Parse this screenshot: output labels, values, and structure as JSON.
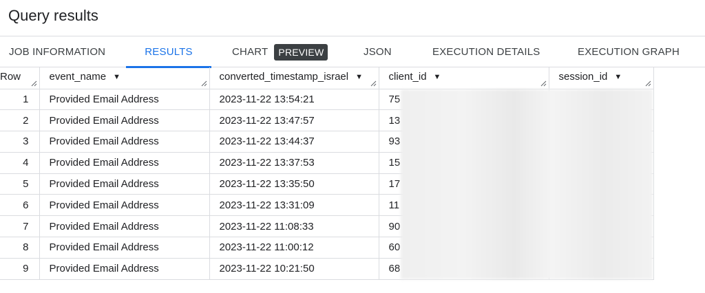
{
  "title": "Query results",
  "tabs": {
    "job_information": "JOB INFORMATION",
    "results": "RESULTS",
    "chart": "CHART",
    "chart_badge": "PREVIEW",
    "json": "JSON",
    "execution_details": "EXECUTION DETAILS",
    "execution_graph": "EXECUTION GRAPH"
  },
  "table": {
    "columns": [
      "Row",
      "event_name",
      "converted_timestamp_israel",
      "client_id",
      "session_id"
    ],
    "rows": [
      {
        "row": "1",
        "event_name": "Provided Email Address",
        "timestamp": "2023-11-22 13:54:21",
        "client_id": "75",
        "session_id": ""
      },
      {
        "row": "2",
        "event_name": "Provided Email Address",
        "timestamp": "2023-11-22 13:47:57",
        "client_id": "13",
        "session_id": ""
      },
      {
        "row": "3",
        "event_name": "Provided Email Address",
        "timestamp": "2023-11-22 13:44:37",
        "client_id": "93",
        "session_id": ""
      },
      {
        "row": "4",
        "event_name": "Provided Email Address",
        "timestamp": "2023-11-22 13:37:53",
        "client_id": "15",
        "session_id": ""
      },
      {
        "row": "5",
        "event_name": "Provided Email Address",
        "timestamp": "2023-11-22 13:35:50",
        "client_id": "17",
        "session_id": ""
      },
      {
        "row": "6",
        "event_name": "Provided Email Address",
        "timestamp": "2023-11-22 13:31:09",
        "client_id": "11",
        "session_id": ""
      },
      {
        "row": "7",
        "event_name": "Provided Email Address",
        "timestamp": "2023-11-22 11:08:33",
        "client_id": "90",
        "session_id": ""
      },
      {
        "row": "8",
        "event_name": "Provided Email Address",
        "timestamp": "2023-11-22 11:00:12",
        "client_id": "60",
        "session_id": ""
      },
      {
        "row": "9",
        "event_name": "Provided Email Address",
        "timestamp": "2023-11-22 10:21:50",
        "client_id": "68",
        "session_id": ""
      }
    ]
  },
  "colors": {
    "accent": "#1a73e8",
    "badge_bg": "#3c4043",
    "border": "#dadce0",
    "text": "#202124"
  },
  "icons": {
    "sort": "caret-down-icon",
    "resize": "resize-grip-icon"
  }
}
